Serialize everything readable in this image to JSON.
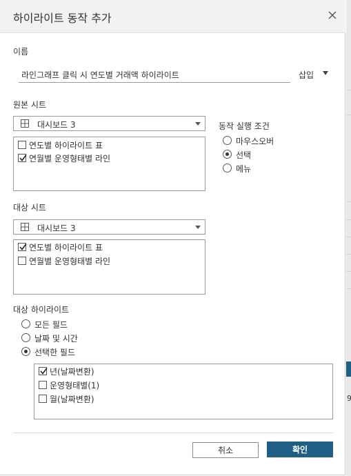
{
  "dialog": {
    "title": "하이라이트 동작 추가"
  },
  "name_section": {
    "label": "이름",
    "value": "라인그래프 클릭 시 연도별 거래액 하이라이트",
    "insert_label": "삽입"
  },
  "source": {
    "label": "원본 시트",
    "select_value": "대시보드 3",
    "sheets": [
      {
        "label": "연도별 하이라이트 표",
        "checked": false
      },
      {
        "label": "연월별 운영형태별 라인",
        "checked": true
      }
    ]
  },
  "run_condition": {
    "label": "동작 실행 조건",
    "options": [
      {
        "label": "마우스오버",
        "selected": false
      },
      {
        "label": "선택",
        "selected": true
      },
      {
        "label": "메뉴",
        "selected": false
      }
    ]
  },
  "target": {
    "label": "대상 시트",
    "select_value": "대시보드 3",
    "sheets": [
      {
        "label": "연도별 하이라이트 표",
        "checked": true
      },
      {
        "label": "연월별 운영형태별 라인",
        "checked": false
      }
    ]
  },
  "target_highlight": {
    "label": "대상 하이라이트",
    "options": [
      {
        "label": "모든 필드",
        "selected": false
      },
      {
        "label": "날짜 및 시간",
        "selected": false
      },
      {
        "label": "선택한 필드",
        "selected": true
      }
    ],
    "fields": [
      {
        "label": "년(날짜변환)",
        "checked": true
      },
      {
        "label": "운영형태별(1)",
        "checked": false
      },
      {
        "label": "월(날짜변환)",
        "checked": false
      }
    ]
  },
  "buttons": {
    "cancel": "취소",
    "ok": "확인"
  },
  "background": {
    "partial_text": "9"
  },
  "colors": {
    "accent": "#1f5f86",
    "title_bar": "#f2f2f2"
  }
}
